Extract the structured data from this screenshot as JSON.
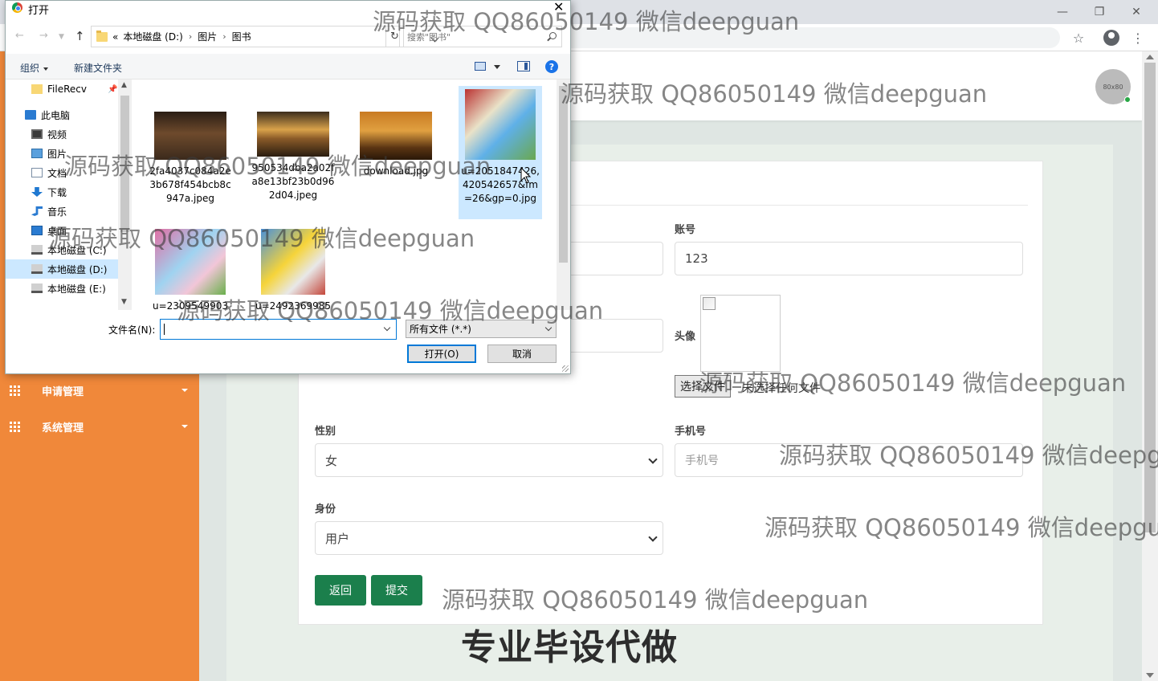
{
  "browser": {
    "window_controls": [
      "—",
      "❐",
      "✕"
    ]
  },
  "header": {
    "avatar_text": "80x80"
  },
  "sidebar": {
    "items": [
      {
        "label": "申请管理"
      },
      {
        "label": "系统管理"
      }
    ]
  },
  "form": {
    "account_label": "账号",
    "account_value": "123",
    "avatar_label": "头像",
    "file_button": "选择文件",
    "file_status": "未选择任何文件",
    "gender_label": "性别",
    "gender_value": "女",
    "phone_label": "手机号",
    "phone_placeholder": "手机号",
    "role_label": "身份",
    "role_value": "用户",
    "back_button": "返回",
    "submit_button": "提交"
  },
  "dialog": {
    "title": "打开",
    "breadcrumb": [
      "«",
      "本地磁盘 (D:)",
      "图片",
      "图书"
    ],
    "search_placeholder": "搜索\"图书\"",
    "organize": "组织",
    "new_folder": "新建文件夹",
    "help": "?",
    "nav_items": [
      {
        "label": "FileRecv",
        "icon": "folder-icon",
        "pinned": true
      },
      {
        "label": "此电脑",
        "icon": "computer-icon"
      },
      {
        "label": "视频",
        "icon": "video-icon"
      },
      {
        "label": "图片",
        "icon": "pictures-icon"
      },
      {
        "label": "文档",
        "icon": "documents-icon"
      },
      {
        "label": "下载",
        "icon": "download-icon"
      },
      {
        "label": "音乐",
        "icon": "music-icon"
      },
      {
        "label": "桌面",
        "icon": "desktop-icon"
      },
      {
        "label": "本地磁盘 (C:)",
        "icon": "drive-icon"
      },
      {
        "label": "本地磁盘 (D:)",
        "icon": "drive-icon",
        "selected": true
      },
      {
        "label": "本地磁盘 (E:)",
        "icon": "drive-icon"
      }
    ],
    "files": [
      {
        "name": "2fa4037c084a2e3b678f454bcb8c947a.jpeg",
        "thumb": "hall"
      },
      {
        "name": "950534dba2a02fa8e13bf23b0d962d04.jpeg",
        "thumb": "sunset"
      },
      {
        "name": "download.jpg",
        "thumb": "castle"
      },
      {
        "name": "u=2051847426,420542657&fm=26&gp=0.jpg",
        "thumb": "book-cartoon",
        "selected": true
      },
      {
        "name": "u=2309549903",
        "thumb": "book-peppa"
      },
      {
        "name": "u=2492369985",
        "thumb": "book-duck"
      }
    ],
    "filename_label": "文件名(N):",
    "filename_value": "",
    "filetype": "所有文件 (*.*)",
    "open_button": "打开(O)",
    "cancel_button": "取消"
  },
  "watermarks": [
    "源码获取 QQ86050149 微信deepguan",
    "源码获取 QQ86050149 微信deepguan",
    "源码获取 QQ86050149 微信deepguan",
    "源码获取 QQ86050149 微信deepguan",
    "源码获取 QQ86050149 微信deepguan",
    "源码获取 QQ86050149 微信deepguan",
    "源码获取 QQ86050149 微信deepg",
    "源码获取 QQ86050149 微信deepgu",
    "源码获取 QQ86050149 微信deepguan"
  ],
  "watermark_big": "专业毕设代做",
  "colors": {
    "sidebar": "#f0883a",
    "button_green": "#1b7f4c",
    "selection": "#cce8ff"
  }
}
